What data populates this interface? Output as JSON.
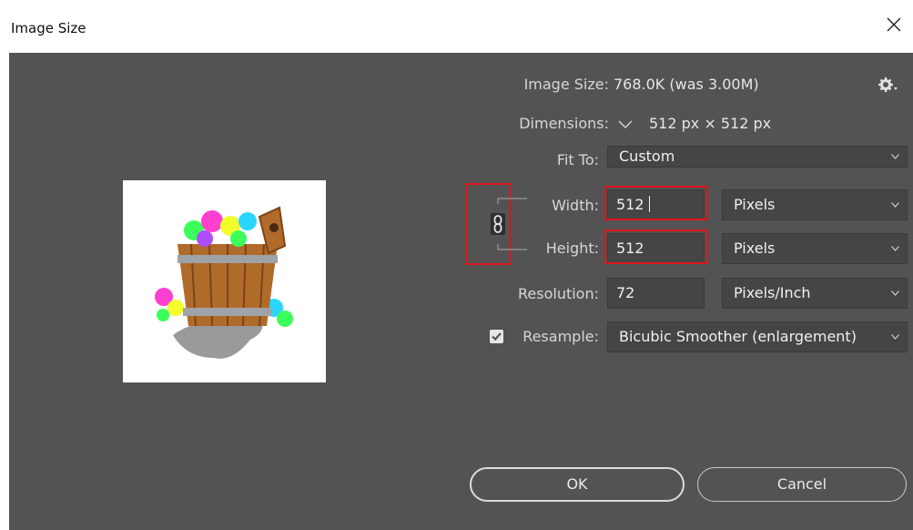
{
  "window": {
    "title": "Image Size"
  },
  "info": {
    "image_size_label": "Image Size:",
    "image_size_value": "768.0K (was 3.00M)",
    "dimensions_label": "Dimensions:",
    "dimensions_value": "512 px  ×  512 px"
  },
  "fit_to": {
    "label": "Fit To:",
    "value": "Custom"
  },
  "width": {
    "label": "Width:",
    "value": "512",
    "unit": "Pixels"
  },
  "height": {
    "label": "Height:",
    "value": "512",
    "unit": "Pixels"
  },
  "resolution": {
    "label": "Resolution:",
    "value": "72",
    "unit": "Pixels/Inch"
  },
  "resample": {
    "label": "Resample:",
    "checked": true,
    "value": "Bicubic Smoother (enlargement)"
  },
  "buttons": {
    "ok": "OK",
    "cancel": "Cancel"
  },
  "colors": {
    "panel_bg": "#535353",
    "field_bg": "#454545",
    "highlight": "#e0141c"
  }
}
